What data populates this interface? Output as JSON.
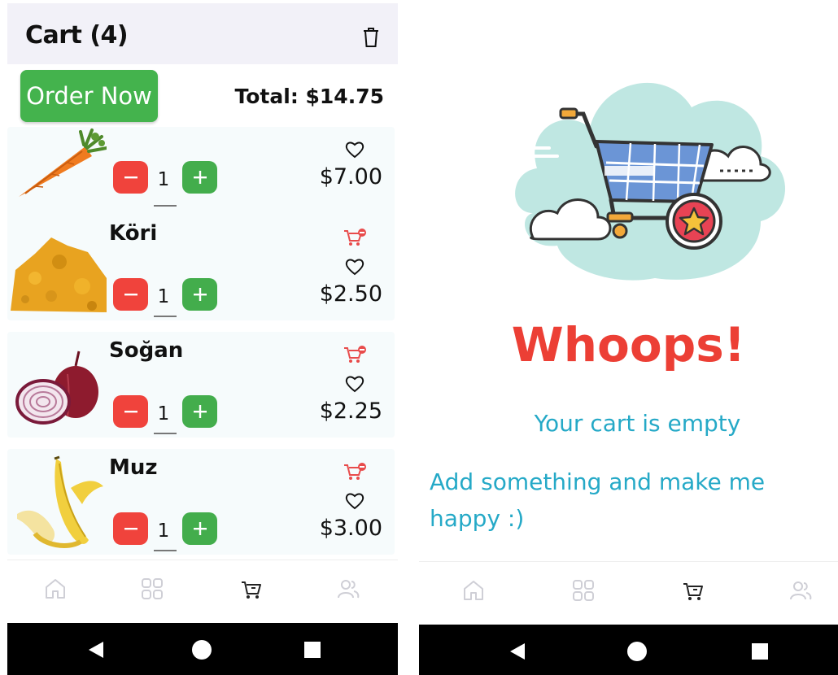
{
  "cart_screen": {
    "header": {
      "title": "Cart (4)",
      "trash_icon": "trash-icon"
    },
    "order_button_label": "Order Now",
    "total_label": "Total: $14.75",
    "items": [
      {
        "name": "",
        "quantity": "1",
        "price": "$7.00",
        "image": "carrot",
        "has_remove": false
      },
      {
        "name": "Köri",
        "quantity": "1",
        "price": "$2.50",
        "image": "curry-powder",
        "has_remove": true
      },
      {
        "name": "Soğan",
        "quantity": "1",
        "price": "$2.25",
        "image": "onion",
        "has_remove": true
      },
      {
        "name": "Muz",
        "quantity": "1",
        "price": "$3.00",
        "image": "banana",
        "has_remove": true
      }
    ],
    "colors": {
      "accent_green": "#44b34d",
      "minus_red": "#f0433c",
      "remove_red": "#e84b4b"
    }
  },
  "empty_screen": {
    "title": "Whoops!",
    "message": "Your cart is empty",
    "hint": "Add something and make me happy :)",
    "colors": {
      "title": "#ec3f35",
      "text": "#25a9c7"
    }
  },
  "bottom_nav": {
    "items": [
      "home-icon",
      "grid-icon",
      "cart-icon",
      "users-icon"
    ],
    "active": "cart-icon"
  }
}
